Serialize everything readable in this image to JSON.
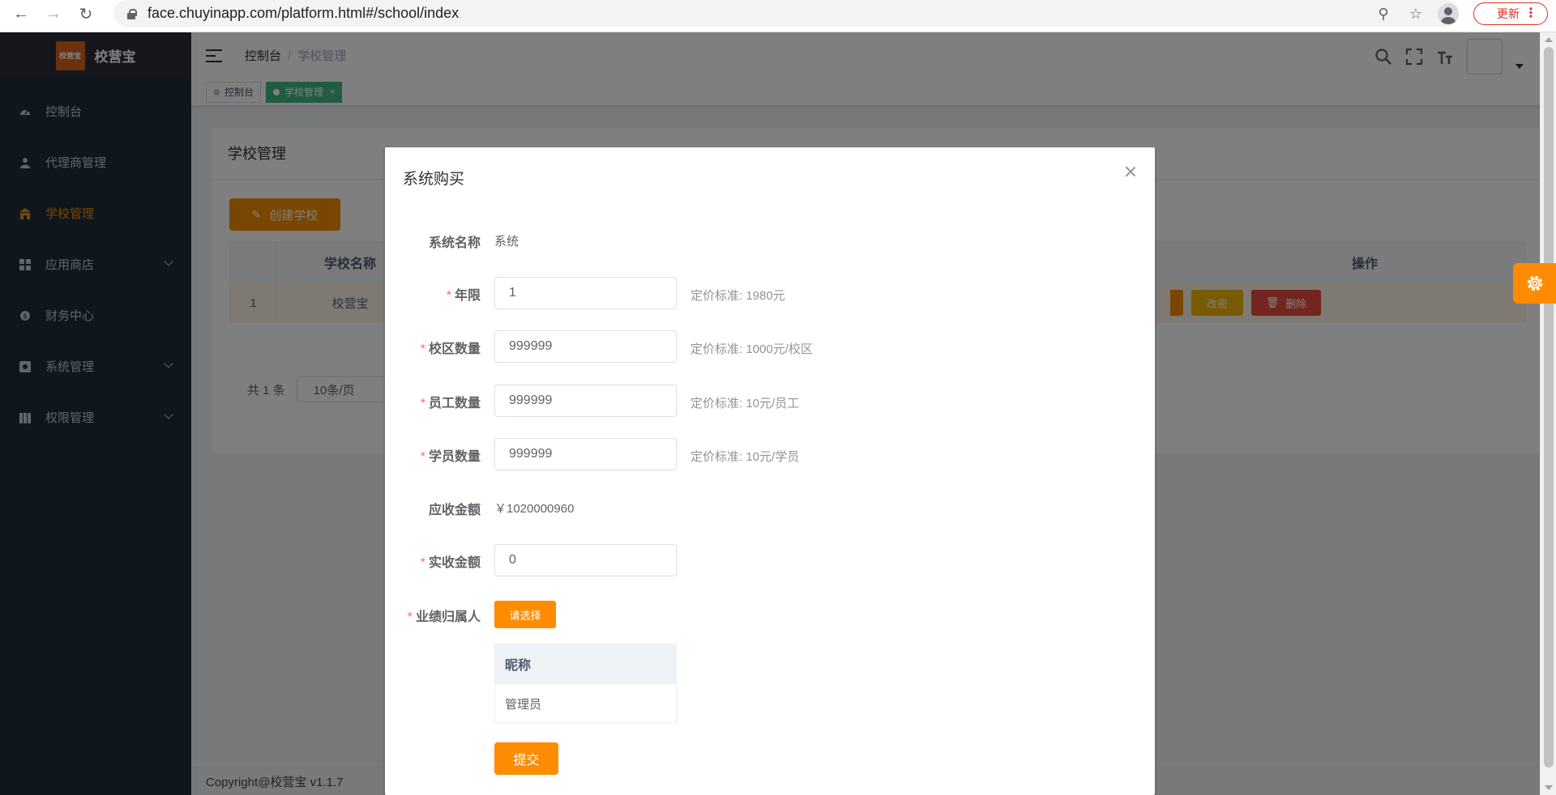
{
  "browser": {
    "url": "face.chuyinapp.com/platform.html#/school/index",
    "update_label": "更新"
  },
  "sidebar": {
    "logo_text": "校营宝",
    "logo_img_text": "校营宝",
    "items": [
      {
        "label": "控制台"
      },
      {
        "label": "代理商管理"
      },
      {
        "label": "学校管理"
      },
      {
        "label": "应用商店"
      },
      {
        "label": "财务中心"
      },
      {
        "label": "系统管理"
      },
      {
        "label": "权限管理"
      }
    ]
  },
  "navbar": {
    "breadcrumb": [
      "控制台",
      "学校管理"
    ]
  },
  "tags": [
    {
      "label": "控制台"
    },
    {
      "label": "学校管理"
    }
  ],
  "page": {
    "title": "学校管理",
    "create_button": "创建学校",
    "table": {
      "headers": [
        "学校名称",
        "操作"
      ],
      "rows": [
        {
          "index": "1",
          "name": "校营宝"
        }
      ],
      "row_buttons": [
        "改密",
        "删除"
      ]
    },
    "pager": {
      "total": "共 1 条",
      "page_size": "10条/页"
    },
    "footer": "Copyright@校营宝 v1.1.7"
  },
  "dialog": {
    "title": "系统购买",
    "fields": {
      "system_name": {
        "label": "系统名称",
        "value": "系统"
      },
      "years": {
        "label": "年限",
        "value": "1",
        "hint": "定价标准: 1980元"
      },
      "campus_count": {
        "label": "校区数量",
        "value": "999999",
        "hint": "定价标准: 1000元/校区"
      },
      "staff_count": {
        "label": "员工数量",
        "value": "999999",
        "hint": "定价标准: 10元/员工"
      },
      "student_count": {
        "label": "学员数量",
        "value": "999999",
        "hint": "定价标准: 10元/学员"
      },
      "receivable": {
        "label": "应收金额",
        "value": "￥1020000960"
      },
      "received": {
        "label": "实收金额",
        "value": "0"
      },
      "owner": {
        "label": "业绩归属人",
        "button": "请选择"
      }
    },
    "owner_table": {
      "header": "昵称",
      "rows": [
        "管理员"
      ]
    },
    "submit": "提交"
  },
  "colors": {
    "accent": "#ff8c00",
    "sidebar_bg": "#1f2d3d",
    "active_tag": "#42b983",
    "delete": "#e74c3c",
    "edit_pwd": "#f0b400"
  }
}
